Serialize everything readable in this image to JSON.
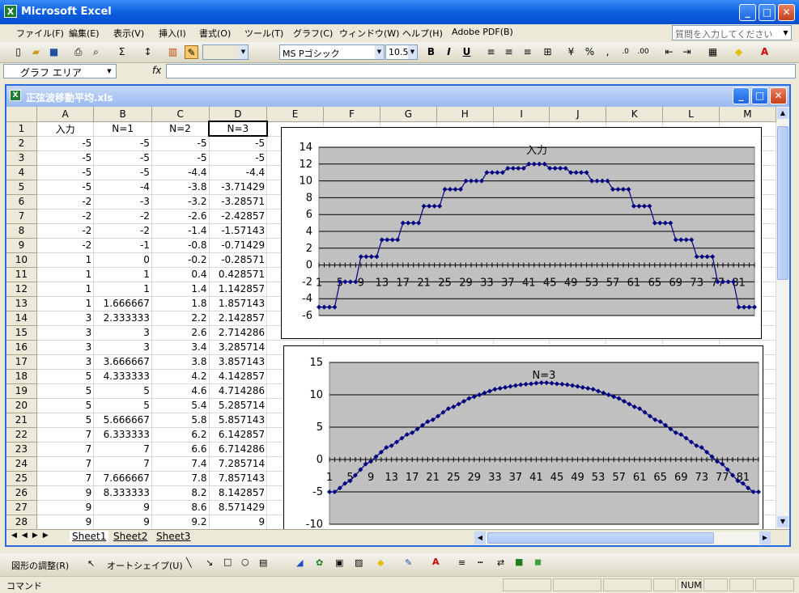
{
  "app": {
    "title": "Microsoft Excel",
    "doc_title": "正弦波移動平均.xls"
  },
  "menu": [
    "ファイル(F)",
    "編集(E)",
    "表示(V)",
    "挿入(I)",
    "書式(O)",
    "ツール(T)",
    "グラフ(C)",
    "ウィンドウ(W)",
    "ヘルプ(H)",
    "Adobe PDF(B)"
  ],
  "help_placeholder": "質問を入力してください",
  "toolbar": {
    "font": "MS Pゴシック",
    "size": "10.5",
    "bold": "B",
    "italic": "I",
    "underline": "U",
    "percent": "%",
    "comma": ","
  },
  "namebox": "グラフ エリア",
  "fx": "fx",
  "columns": [
    "A",
    "B",
    "C",
    "D",
    "E",
    "F",
    "G",
    "H",
    "I",
    "J",
    "K",
    "L",
    "M"
  ],
  "rows": [
    {
      "n": "1",
      "a": "入力",
      "b": "N=1",
      "c": "N=2",
      "d": "N=3"
    },
    {
      "n": "2",
      "a": "-5",
      "b": "-5",
      "c": "-5",
      "d": "-5"
    },
    {
      "n": "3",
      "a": "-5",
      "b": "-5",
      "c": "-5",
      "d": "-5"
    },
    {
      "n": "4",
      "a": "-5",
      "b": "-5",
      "c": "-4.4",
      "d": "-4.4"
    },
    {
      "n": "5",
      "a": "-5",
      "b": "-4",
      "c": "-3.8",
      "d": "-3.71429"
    },
    {
      "n": "6",
      "a": "-2",
      "b": "-3",
      "c": "-3.2",
      "d": "-3.28571"
    },
    {
      "n": "7",
      "a": "-2",
      "b": "-2",
      "c": "-2.6",
      "d": "-2.42857"
    },
    {
      "n": "8",
      "a": "-2",
      "b": "-2",
      "c": "-1.4",
      "d": "-1.57143"
    },
    {
      "n": "9",
      "a": "-2",
      "b": "-1",
      "c": "-0.8",
      "d": "-0.71429"
    },
    {
      "n": "10",
      "a": "1",
      "b": "0",
      "c": "-0.2",
      "d": "-0.28571"
    },
    {
      "n": "11",
      "a": "1",
      "b": "1",
      "c": "0.4",
      "d": "0.428571"
    },
    {
      "n": "12",
      "a": "1",
      "b": "1",
      "c": "1.4",
      "d": "1.142857"
    },
    {
      "n": "13",
      "a": "1",
      "b": "1.666667",
      "c": "1.8",
      "d": "1.857143"
    },
    {
      "n": "14",
      "a": "3",
      "b": "2.333333",
      "c": "2.2",
      "d": "2.142857"
    },
    {
      "n": "15",
      "a": "3",
      "b": "3",
      "c": "2.6",
      "d": "2.714286"
    },
    {
      "n": "16",
      "a": "3",
      "b": "3",
      "c": "3.4",
      "d": "3.285714"
    },
    {
      "n": "17",
      "a": "3",
      "b": "3.666667",
      "c": "3.8",
      "d": "3.857143"
    },
    {
      "n": "18",
      "a": "5",
      "b": "4.333333",
      "c": "4.2",
      "d": "4.142857"
    },
    {
      "n": "19",
      "a": "5",
      "b": "5",
      "c": "4.6",
      "d": "4.714286"
    },
    {
      "n": "20",
      "a": "5",
      "b": "5",
      "c": "5.4",
      "d": "5.285714"
    },
    {
      "n": "21",
      "a": "5",
      "b": "5.666667",
      "c": "5.8",
      "d": "5.857143"
    },
    {
      "n": "22",
      "a": "7",
      "b": "6.333333",
      "c": "6.2",
      "d": "6.142857"
    },
    {
      "n": "23",
      "a": "7",
      "b": "7",
      "c": "6.6",
      "d": "6.714286"
    },
    {
      "n": "24",
      "a": "7",
      "b": "7",
      "c": "7.4",
      "d": "7.285714"
    },
    {
      "n": "25",
      "a": "7",
      "b": "7.666667",
      "c": "7.8",
      "d": "7.857143"
    },
    {
      "n": "26",
      "a": "9",
      "b": "8.333333",
      "c": "8.2",
      "d": "8.142857"
    },
    {
      "n": "27",
      "a": "9",
      "b": "9",
      "c": "8.6",
      "d": "8.571429"
    },
    {
      "n": "28",
      "a": "9",
      "b": "9",
      "c": "9.2",
      "d": "9"
    }
  ],
  "sheets": [
    "Sheet1",
    "Sheet2",
    "Sheet3"
  ],
  "drawbar": {
    "adjust": "図形の調整(R)",
    "autoshape": "オートシェイプ(U)"
  },
  "status": {
    "mode": "コマンド",
    "num": "NUM"
  },
  "chart_data": [
    {
      "type": "line",
      "title": "入力",
      "ylim": [
        -6,
        14
      ],
      "yticks": [
        14,
        12,
        10,
        8,
        6,
        4,
        2,
        0,
        -2,
        -4,
        -6
      ],
      "xticks": [
        "1",
        "5",
        "9",
        "13",
        "17",
        "21",
        "25",
        "29",
        "33",
        "37",
        "41",
        "45",
        "49",
        "53",
        "57",
        "61",
        "65",
        "69",
        "73",
        "77",
        "81"
      ],
      "series": [
        {
          "color": "#000080",
          "values": [
            -5,
            -5,
            -5,
            -5,
            -2,
            -2,
            -2,
            -2,
            1,
            1,
            1,
            1,
            3,
            3,
            3,
            3,
            5,
            5,
            5,
            5,
            7,
            7,
            7,
            7,
            9,
            9,
            9,
            9,
            10,
            10,
            10,
            10,
            11,
            11,
            11,
            11,
            11.5,
            11.5,
            11.5,
            11.5,
            12,
            12,
            12,
            12,
            11.5,
            11.5,
            11.5,
            11.5,
            11,
            11,
            11,
            11,
            10,
            10,
            10,
            10,
            9,
            9,
            9,
            9,
            7,
            7,
            7,
            7,
            5,
            5,
            5,
            5,
            3,
            3,
            3,
            3,
            1,
            1,
            1,
            1,
            -2,
            -2,
            -2,
            -2,
            -5,
            -5,
            -5,
            -5
          ]
        }
      ],
      "grid": true
    },
    {
      "type": "line",
      "title": "N=3",
      "ylim": [
        -10,
        15
      ],
      "yticks": [
        15,
        10,
        5,
        0,
        -5,
        -10
      ],
      "xticks": [
        "1",
        "5",
        "9",
        "13",
        "17",
        "21",
        "25",
        "29",
        "33",
        "37",
        "41",
        "45",
        "49",
        "53",
        "57",
        "61",
        "65",
        "69",
        "73",
        "77",
        "81"
      ],
      "series": [
        {
          "color": "#000080",
          "values": [
            -5,
            -5,
            -4.4,
            -3.71,
            -3.29,
            -2.43,
            -1.57,
            -0.71,
            -0.29,
            0.43,
            1.14,
            1.86,
            2.14,
            2.71,
            3.29,
            3.86,
            4.14,
            4.71,
            5.29,
            5.86,
            6.14,
            6.71,
            7.29,
            7.86,
            8.14,
            8.57,
            9,
            9.43,
            9.71,
            10,
            10.29,
            10.57,
            10.86,
            11,
            11.14,
            11.29,
            11.43,
            11.57,
            11.64,
            11.71,
            11.79,
            11.86,
            11.86,
            11.79,
            11.71,
            11.64,
            11.57,
            11.43,
            11.29,
            11.14,
            11,
            10.86,
            10.57,
            10.29,
            10,
            9.71,
            9.43,
            9,
            8.57,
            8.14,
            7.86,
            7.29,
            6.71,
            6.14,
            5.86,
            5.29,
            4.71,
            4.14,
            3.86,
            3.29,
            2.71,
            2.14,
            1.86,
            1.14,
            0.43,
            -0.29,
            -0.71,
            -1.57,
            -2.43,
            -3.29,
            -3.71,
            -4.4,
            -5,
            -5
          ]
        }
      ],
      "grid": true
    }
  ]
}
